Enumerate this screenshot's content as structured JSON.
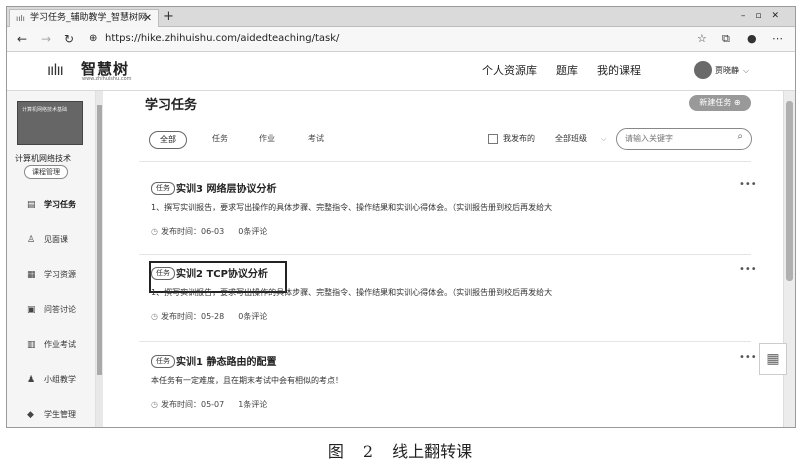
{
  "browser": {
    "tab_title": "学习任务_辅助教学_智慧树网",
    "url": "https://hike.zhihuishu.com/aidedteaching/task/"
  },
  "header": {
    "logo_text": "智慧树",
    "logo_sub": "www.zhihuishu.com",
    "nav": [
      "个人资源库",
      "题库",
      "我的课程"
    ],
    "user_name": "贾晓静"
  },
  "sidebar": {
    "course_cover_text": "计算机网络技术基础",
    "course_name": "计算机网络技术",
    "manage_label": "课程管理",
    "items": [
      {
        "label": "学习任务",
        "icon": "task-icon"
      },
      {
        "label": "见面课",
        "icon": "person-icon"
      },
      {
        "label": "学习资源",
        "icon": "folder-icon"
      },
      {
        "label": "问答讨论",
        "icon": "chat-icon"
      },
      {
        "label": "作业考试",
        "icon": "book-icon"
      },
      {
        "label": "小组教学",
        "icon": "group-icon"
      },
      {
        "label": "学生管理",
        "icon": "graduation-icon"
      }
    ]
  },
  "main": {
    "title": "学习任务",
    "new_button": "新建任务",
    "filters": [
      "全部",
      "任务",
      "作业",
      "考试"
    ],
    "mine_label": "我发布的",
    "class_select": "全部班级",
    "search_placeholder": "请输入关键字",
    "tasks": [
      {
        "tag": "任务",
        "title": "实训3 网络层协议分析",
        "desc": "1、撰写实训报告，要求写出操作的具体步骤、完整指令、操作结果和实训心得体会。（实训报告册到校后再发给大",
        "time": "发布时间：06-03",
        "comments": "0条评论"
      },
      {
        "tag": "任务",
        "title": "实训2 TCP协议分析",
        "desc": "1、撰写实训报告，要求写出操作的具体步骤、完整指令、操作结果和实训心得体会。（实训报告册到校后再发给大",
        "time": "发布时间：05-28",
        "comments": "0条评论"
      },
      {
        "tag": "任务",
        "title": "实训1 静态路由的配置",
        "desc": "本任务有一定难度，且在期末考试中会有相似的考点！",
        "time": "发布时间：05-07",
        "comments": "1条评论"
      }
    ]
  },
  "caption": "图 2   线上翻转课"
}
